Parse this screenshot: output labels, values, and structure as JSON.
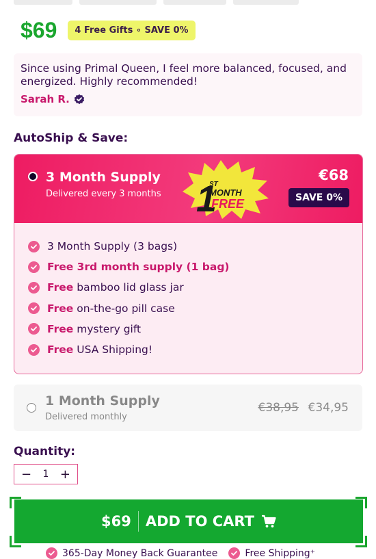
{
  "header": {
    "price": "$69",
    "gift_badge": "4 Free Gifts ∘ SAVE 0%"
  },
  "testimonial": {
    "quote": "Since using Primal Queen, I feel more balanced, focused, and energized. Highly recommended!",
    "author": "Sarah R."
  },
  "autoship": {
    "label": "AutoShip & Save:",
    "plan3": {
      "title": "3 Month Supply",
      "subtitle": "Delivered every 3 months",
      "price": "€68",
      "save_badge": "SAVE 0%",
      "badge_line1": "1",
      "badge_sup": "ST",
      "badge_line2": "MONTH",
      "badge_line3": "FREE",
      "features": [
        {
          "highlight": "",
          "text": "3 Month Supply (3 bags)"
        },
        {
          "highlight": "Free 3rd month supply (1 bag)",
          "text": ""
        },
        {
          "highlight": "Free",
          "text": "bamboo lid glass jar"
        },
        {
          "highlight": "Free",
          "text": "on-the-go pill case"
        },
        {
          "highlight": "Free",
          "text": "mystery gift"
        },
        {
          "highlight": "Free",
          "text": "USA Shipping!"
        }
      ]
    },
    "plan1": {
      "title": "1 Month Supply",
      "subtitle": "Delivered monthly",
      "old_price": "€38,95",
      "price": "€34,95"
    }
  },
  "quantity": {
    "label": "Quantity:",
    "value": "1",
    "minus": "−",
    "plus": "+"
  },
  "cart": {
    "price": "$69",
    "label": "ADD TO CART"
  },
  "guarantees": {
    "money_back": "365-Day Money Back Guarantee",
    "shipping": "Free Shipping⁺"
  },
  "colors": {
    "accent_green": "#14a830",
    "accent_pink": "#ee1c62",
    "badge_yellow": "#eef56a",
    "dark_purple": "#2a0a4a"
  }
}
